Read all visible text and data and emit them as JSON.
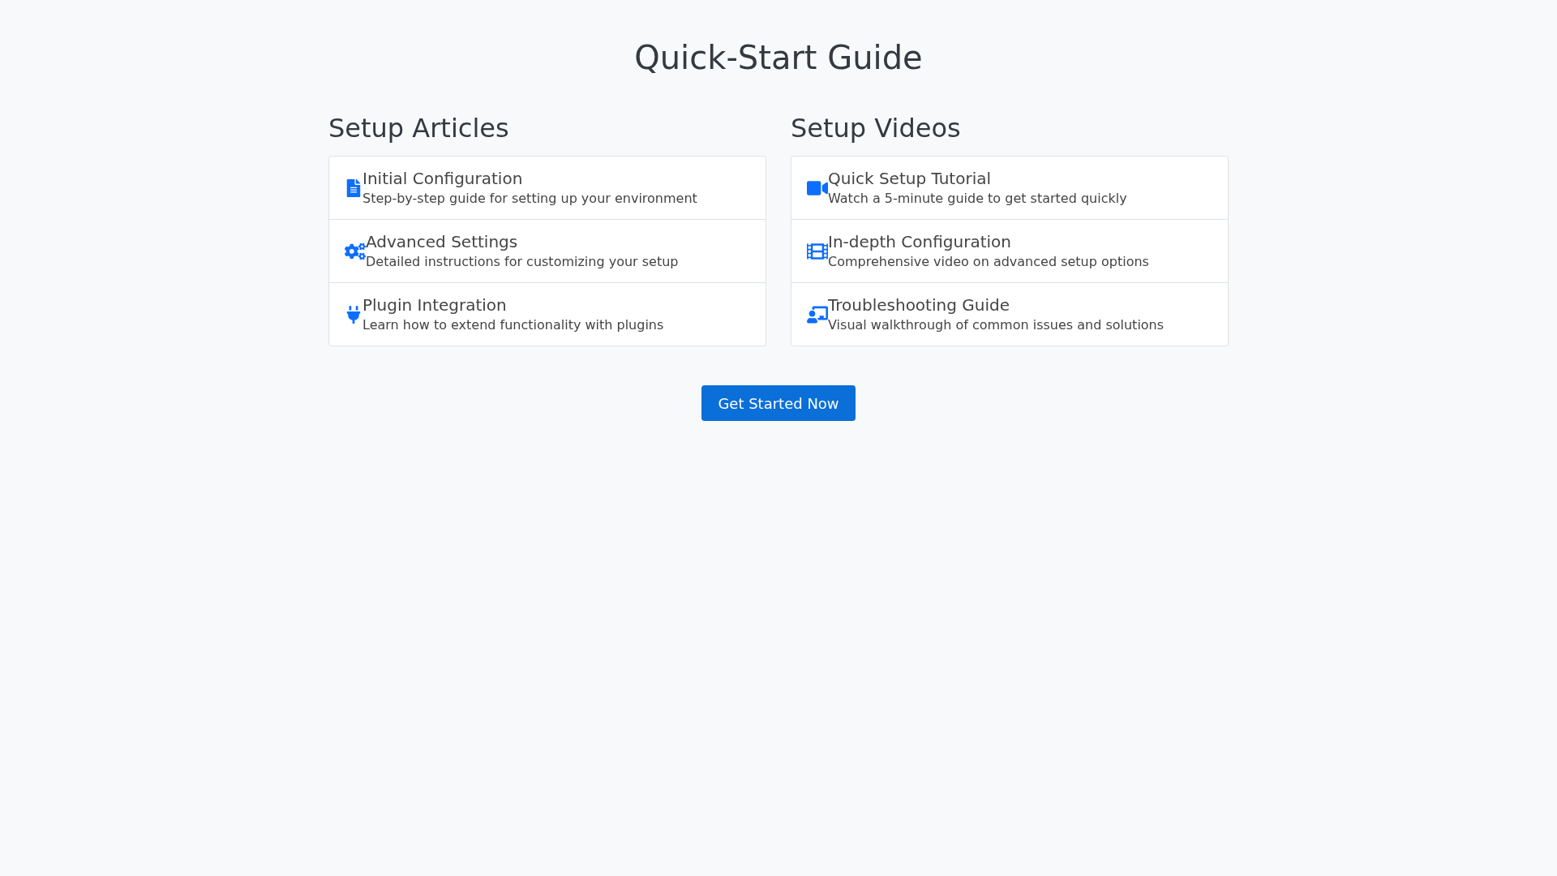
{
  "page_title": "Quick-Start Guide",
  "sections": [
    {
      "heading": "Setup Articles",
      "items": [
        {
          "title": "Initial Configuration",
          "description": "Step-by-step guide for setting up your environment"
        },
        {
          "title": "Advanced Settings",
          "description": "Detailed instructions for customizing your setup"
        },
        {
          "title": "Plugin Integration",
          "description": "Learn how to extend functionality with plugins"
        }
      ]
    },
    {
      "heading": "Setup Videos",
      "items": [
        {
          "title": "Quick Setup Tutorial",
          "description": "Watch a 5-minute guide to get started quickly"
        },
        {
          "title": "In-depth Configuration",
          "description": "Comprehensive video on advanced setup options"
        },
        {
          "title": "Troubleshooting Guide",
          "description": "Visual walkthrough of common issues and solutions"
        }
      ]
    }
  ],
  "button": "Get Started Now"
}
